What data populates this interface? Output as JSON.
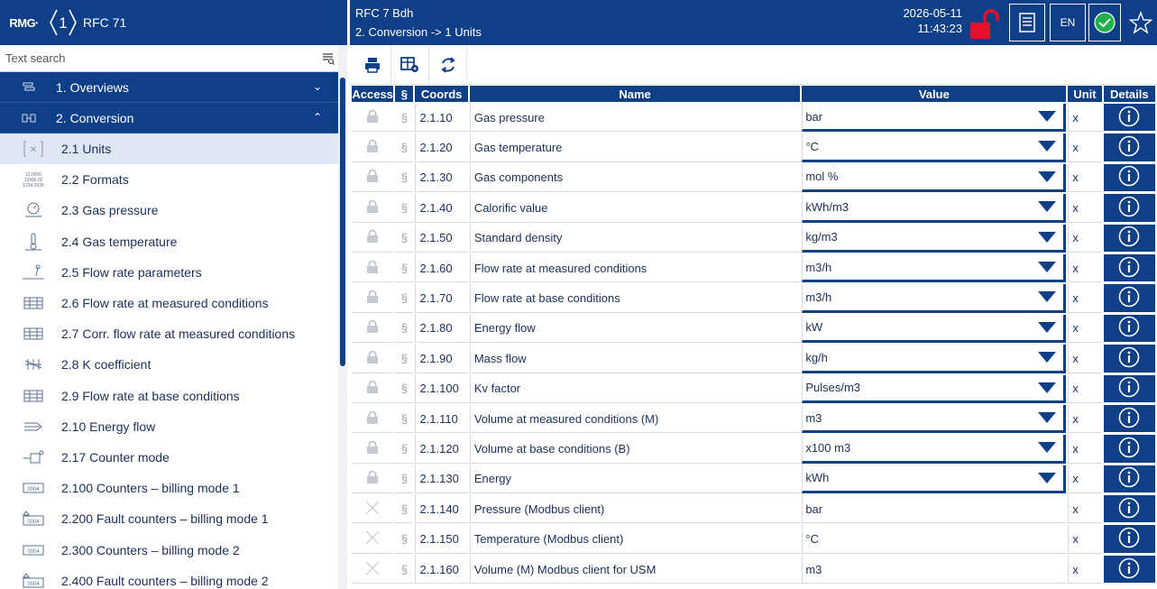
{
  "app": {
    "logo_text": "RMG",
    "badge_number": "1",
    "title": "RFC 71"
  },
  "search": {
    "placeholder": "Text search"
  },
  "nav": {
    "groups": [
      {
        "label": "1. Overviews",
        "expanded": false
      },
      {
        "label": "2. Conversion",
        "expanded": true
      }
    ],
    "items": [
      {
        "label": "2.1 Units",
        "icon": "units-icon",
        "active": true
      },
      {
        "label": "2.2 Formats",
        "icon": "formats-icon"
      },
      {
        "label": "2.3 Gas pressure",
        "icon": "gauge-icon"
      },
      {
        "label": "2.4 Gas temperature",
        "icon": "thermometer-icon"
      },
      {
        "label": "2.5 Flow rate parameters",
        "icon": "flow-params-icon"
      },
      {
        "label": "2.6 Flow rate at measured conditions",
        "icon": "flow-meter-icon"
      },
      {
        "label": "2.7 Corr. flow rate at measured conditions",
        "icon": "flow-meter-icon"
      },
      {
        "label": "2.8 K coefficient",
        "icon": "k-coefficient-icon"
      },
      {
        "label": "2.9 Flow rate at base conditions",
        "icon": "flow-meter-icon"
      },
      {
        "label": "2.10 Energy flow",
        "icon": "energy-flow-icon"
      },
      {
        "label": "2.17 Counter mode",
        "icon": "counter-mode-icon"
      },
      {
        "label": "2.100 Counters – billing mode 1",
        "icon": "counter-icon"
      },
      {
        "label": "2.200 Fault counters – billing mode 1",
        "icon": "fault-counter-icon"
      },
      {
        "label": "2.300 Counters – billing mode 2",
        "icon": "counter-icon"
      },
      {
        "label": "2.400 Fault counters – billing mode 2",
        "icon": "fault-counter-icon"
      }
    ]
  },
  "header": {
    "device": "RFC 7  Bdh",
    "breadcrumb": "2. Conversion -> 1 Units",
    "date": "2026-05-11",
    "time": "11:43:23",
    "language": "EN"
  },
  "toolbar": {
    "icons": [
      "print-icon",
      "table-settings-icon",
      "refresh-icon"
    ]
  },
  "table": {
    "headers": {
      "access": "Access",
      "para": "§",
      "coords": "Coords",
      "name": "Name",
      "value": "Value",
      "unit": "Unit",
      "details": "Details"
    },
    "rows": [
      {
        "access": "locked",
        "coords": "2.1.10",
        "name": "Gas pressure",
        "value": "bar",
        "select": true,
        "unit": "x"
      },
      {
        "access": "locked",
        "coords": "2.1.20",
        "name": "Gas temperature",
        "value": "°C",
        "select": true,
        "unit": "x"
      },
      {
        "access": "locked",
        "coords": "2.1.30",
        "name": "Gas components",
        "value": "mol %",
        "select": true,
        "unit": "x"
      },
      {
        "access": "locked",
        "coords": "2.1.40",
        "name": "Calorific value",
        "value": "kWh/m3",
        "select": true,
        "unit": "x"
      },
      {
        "access": "locked",
        "coords": "2.1.50",
        "name": "Standard density",
        "value": "kg/m3",
        "select": true,
        "unit": "x"
      },
      {
        "access": "locked",
        "coords": "2.1.60",
        "name": "Flow rate at measured conditions",
        "value": "m3/h",
        "select": true,
        "unit": "x"
      },
      {
        "access": "locked",
        "coords": "2.1.70",
        "name": "Flow rate at base conditions",
        "value": "m3/h",
        "select": true,
        "unit": "x"
      },
      {
        "access": "locked",
        "coords": "2.1.80",
        "name": "Energy flow",
        "value": "kW",
        "select": true,
        "unit": "x"
      },
      {
        "access": "locked",
        "coords": "2.1.90",
        "name": "Mass flow",
        "value": "kg/h",
        "select": true,
        "unit": "x"
      },
      {
        "access": "locked",
        "coords": "2.1.100",
        "name": "Kv factor",
        "value": "Pulses/m3",
        "select": true,
        "unit": "x"
      },
      {
        "access": "locked",
        "coords": "2.1.110",
        "name": "Volume at measured conditions (M)",
        "value": "m3",
        "select": true,
        "unit": "x"
      },
      {
        "access": "locked",
        "coords": "2.1.120",
        "name": "Volume at base conditions (B)",
        "value": "x100 m3",
        "select": true,
        "unit": "x"
      },
      {
        "access": "locked",
        "coords": "2.1.130",
        "name": "Energy",
        "value": "kWh",
        "select": true,
        "unit": "x"
      },
      {
        "access": "readonly",
        "coords": "2.1.140",
        "name": "Pressure (Modbus client)",
        "value": "bar",
        "select": false,
        "unit": "x"
      },
      {
        "access": "readonly",
        "coords": "2.1.150",
        "name": "Temperature (Modbus client)",
        "value": "°C",
        "select": false,
        "unit": "x"
      },
      {
        "access": "readonly",
        "coords": "2.1.160",
        "name": "Volume (M) Modbus client for USM",
        "value": "m3",
        "select": false,
        "unit": "x"
      }
    ]
  },
  "colors": {
    "primary": "#0f3f86",
    "lock_open": "#e8102a",
    "ok": "#22b04b",
    "active_item_bg": "#dfe7f4"
  }
}
